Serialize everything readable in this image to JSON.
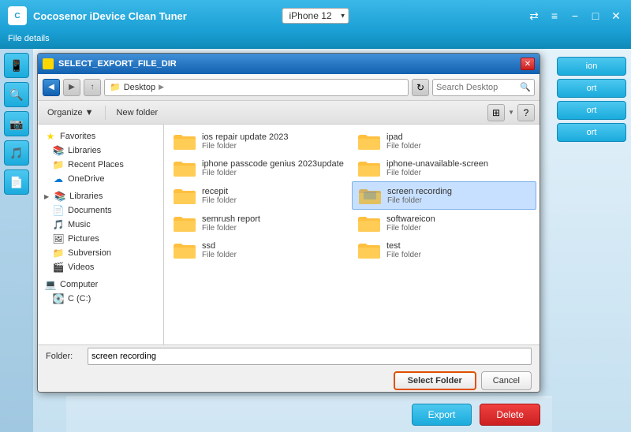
{
  "app": {
    "title": "Cocosenor iDevice Clean Tuner",
    "subtitle": "File details",
    "logo": "C"
  },
  "titlebar": {
    "device_label": "iPhone 12",
    "share_btn": "⇄",
    "menu_btn": "≡",
    "min_btn": "−",
    "max_btn": "□",
    "close_btn": "✕"
  },
  "dialog": {
    "title": "SELECT_EXPORT_FILE_DIR",
    "close_btn": "✕",
    "nav": {
      "back_btn": "◀",
      "forward_btn": "▶",
      "up_btn": "▲",
      "path": "Desktop",
      "path_arrow": "▶",
      "refresh_btn": "↻",
      "search_placeholder": "Search Desktop"
    },
    "toolbar": {
      "organize_label": "Organize",
      "organize_arrow": "▼",
      "new_folder_label": "New folder",
      "view_btn": "▦",
      "view_arrow": "▼",
      "help_btn": "?"
    },
    "tree": {
      "favorites_label": "Favorites",
      "libraries_label": "Libraries",
      "recent_places_label": "Recent Places",
      "onedrive_label": "OneDrive",
      "libraries_section_label": "Libraries",
      "documents_label": "Documents",
      "music_label": "Music",
      "pictures_label": "Pictures",
      "subversion_label": "Subversion",
      "videos_label": "Videos",
      "computer_label": "Computer",
      "c_drive_label": "C (C:)"
    },
    "files": [
      {
        "name": "ios repair update 2023",
        "type": "File folder",
        "selected": false
      },
      {
        "name": "ipad",
        "type": "File folder",
        "selected": false
      },
      {
        "name": "iphone passcode genius 2023update",
        "type": "File folder",
        "selected": false
      },
      {
        "name": "iphone-unavailable-screen",
        "type": "File folder",
        "selected": false
      },
      {
        "name": "recepit",
        "type": "File folder",
        "selected": false
      },
      {
        "name": "screen recording",
        "type": "File folder",
        "selected": true
      },
      {
        "name": "semrush report",
        "type": "File folder",
        "selected": false
      },
      {
        "name": "softwareicon",
        "type": "File folder",
        "selected": false
      },
      {
        "name": "ssd",
        "type": "File folder",
        "selected": false
      },
      {
        "name": "test",
        "type": "File folder",
        "selected": false
      }
    ],
    "footer": {
      "folder_label": "Folder:",
      "folder_value": "screen recording",
      "select_btn": "Select Folder",
      "cancel_btn": "Cancel"
    }
  },
  "bottom_bar": {
    "export_btn": "Export",
    "delete_btn": "Delete"
  },
  "right_buttons": [
    "ion",
    "ort",
    "ort",
    "ort"
  ]
}
